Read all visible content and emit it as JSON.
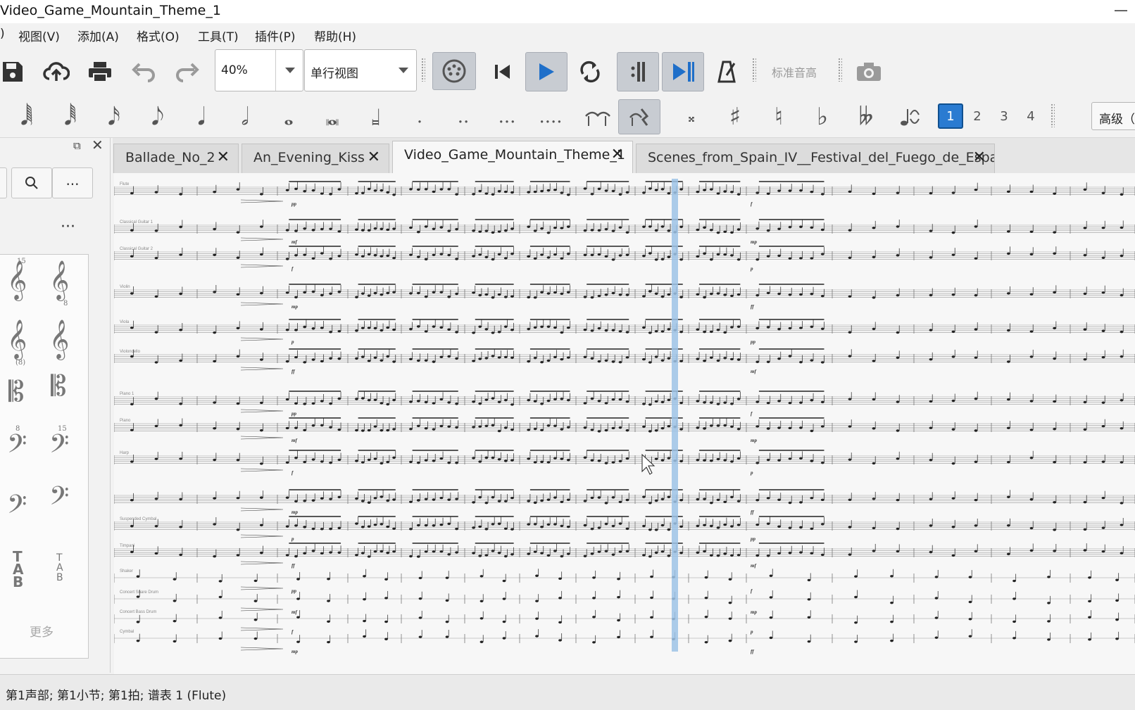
{
  "window": {
    "title": "Video_Game_Mountain_Theme_1",
    "minimize_glyph": "—"
  },
  "menu": {
    "items": [
      "视图(V)",
      "添加(A)",
      "格式(O)",
      "工具(T)",
      "插件(P)",
      "帮助(H)"
    ],
    "partial_left": ")"
  },
  "toolbar": {
    "zoom_value": "40%",
    "view_mode": "单行视图",
    "standard_pitch": "标准音高"
  },
  "notebar": {
    "voices": [
      "1",
      "2",
      "3",
      "4"
    ],
    "selected_voice": "1",
    "advanced": "高级（"
  },
  "palette": {
    "more_label": "更多",
    "clef_digits": [
      "15",
      "8",
      "(8)",
      "8",
      "15"
    ]
  },
  "tabs": [
    {
      "label": "Ballade_No_2"
    },
    {
      "label": "An_Evening_Kiss"
    },
    {
      "label": "Video_Game_Mountain_Theme_1"
    },
    {
      "label": "Scenes_from_Spain_IV__Festival_del_Fuego_de_Espaa"
    }
  ],
  "active_tab": "Video_Game_Mountain_Theme_1",
  "score": {
    "instruments": [
      "Flute",
      "Classical Guitar 1",
      "Classical Guitar 2",
      "Violin",
      "Viola",
      "Violoncello",
      "Piano 1",
      "Piano",
      "Harp",
      "",
      "Suspended Cymbal",
      "Timpani",
      "Shaker",
      "Concert Snare Drum",
      "Concert Bass Drum",
      "Cymbal"
    ],
    "dynamics": [
      "pp",
      "mf",
      "f",
      "mp",
      "p",
      "ff"
    ]
  },
  "status": {
    "text": "第1声部;  第1小节; 第1拍; 谱表 1 (Flute)"
  },
  "colors": {
    "accent": "#2a7bd1",
    "playback_cursor": "#9ec3e6"
  }
}
